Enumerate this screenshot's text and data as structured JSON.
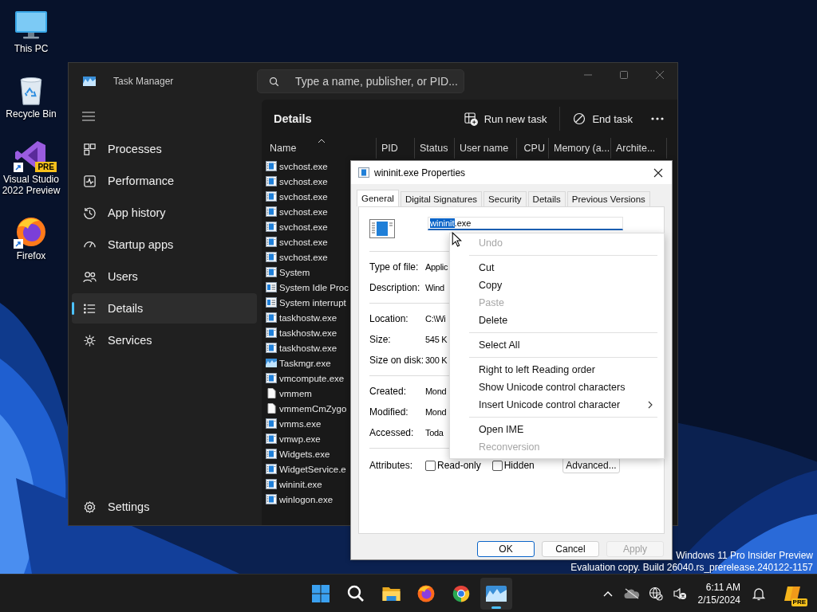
{
  "desktop_icons": [
    {
      "label": "This PC",
      "kind": "pc"
    },
    {
      "label": "Recycle Bin",
      "kind": "bin"
    },
    {
      "label": "Visual Studio 2022 Preview",
      "kind": "vs",
      "badge": "PRE"
    },
    {
      "label": "Firefox",
      "kind": "firefox"
    }
  ],
  "task_manager": {
    "title": "Task Manager",
    "search": {
      "placeholder": "Type a name, publisher, or PID..."
    },
    "nav": [
      {
        "label": "Processes",
        "kind": "processes",
        "selected": false
      },
      {
        "label": "Performance",
        "kind": "performance",
        "selected": false
      },
      {
        "label": "App history",
        "kind": "history",
        "selected": false
      },
      {
        "label": "Startup apps",
        "kind": "startup",
        "selected": false
      },
      {
        "label": "Users",
        "kind": "users",
        "selected": false
      },
      {
        "label": "Details",
        "kind": "details",
        "selected": true
      },
      {
        "label": "Services",
        "kind": "services",
        "selected": false
      }
    ],
    "settings": "Settings",
    "page_title": "Details",
    "actions": [
      {
        "label": "Run new task",
        "kind": "run"
      },
      {
        "label": "End task",
        "kind": "end"
      }
    ],
    "columns": [
      {
        "label": "Name",
        "sorted": true
      },
      {
        "label": "PID",
        "sorted": false
      },
      {
        "label": "Status",
        "sorted": false
      },
      {
        "label": "User name",
        "sorted": false
      },
      {
        "label": "CPU",
        "sorted": false
      },
      {
        "label": "Memory (a...",
        "sorted": false
      },
      {
        "label": "Archite...",
        "sorted": false
      }
    ],
    "rows": [
      {
        "name": "svchost.exe",
        "kind": "exe"
      },
      {
        "name": "svchost.exe",
        "kind": "exe"
      },
      {
        "name": "svchost.exe",
        "kind": "exe"
      },
      {
        "name": "svchost.exe",
        "kind": "exe"
      },
      {
        "name": "svchost.exe",
        "kind": "exe"
      },
      {
        "name": "svchost.exe",
        "kind": "exe"
      },
      {
        "name": "svchost.exe",
        "kind": "exe"
      },
      {
        "name": "System",
        "kind": "exe"
      },
      {
        "name": "System Idle Proc",
        "kind": "system"
      },
      {
        "name": "System interrupt",
        "kind": "system"
      },
      {
        "name": "taskhostw.exe",
        "kind": "exe"
      },
      {
        "name": "taskhostw.exe",
        "kind": "exe"
      },
      {
        "name": "taskhostw.exe",
        "kind": "exe"
      },
      {
        "name": "Taskmgr.exe",
        "kind": "taskmgr"
      },
      {
        "name": "vmcompute.exe",
        "kind": "exe"
      },
      {
        "name": "vmmem",
        "kind": "file"
      },
      {
        "name": "vmmemCmZygo",
        "kind": "file"
      },
      {
        "name": "vmms.exe",
        "kind": "exe"
      },
      {
        "name": "vmwp.exe",
        "kind": "exe"
      },
      {
        "name": "Widgets.exe",
        "kind": "exe"
      },
      {
        "name": "WidgetService.e",
        "kind": "exe"
      },
      {
        "name": "wininit.exe",
        "kind": "exe"
      },
      {
        "name": "winlogon.exe",
        "kind": "exe"
      }
    ]
  },
  "properties": {
    "title": "wininit.exe Properties",
    "tabs": [
      {
        "label": "General",
        "selected": true
      },
      {
        "label": "Digital Signatures",
        "selected": false
      },
      {
        "label": "Security",
        "selected": false
      },
      {
        "label": "Details",
        "selected": false
      },
      {
        "label": "Previous Versions",
        "selected": false
      }
    ],
    "file_name": {
      "selected_text": "wininit",
      "text": ".exe"
    },
    "groups": [
      [
        {
          "label": "Type of file:",
          "value": "Applic"
        },
        {
          "label": "Description:",
          "value": "Wind"
        }
      ],
      [
        {
          "label": "Location:",
          "value": "C:\\Wi"
        },
        {
          "label": "Size:",
          "value": "545 K"
        },
        {
          "label": "Size on disk:",
          "value": "300 K"
        }
      ],
      [
        {
          "label": "Created:",
          "value": "Mond"
        },
        {
          "label": "Modified:",
          "value": "Mond"
        },
        {
          "label": "Accessed:",
          "value": "Toda"
        }
      ]
    ],
    "attributes": {
      "label": "Attributes:",
      "checkboxes": [
        {
          "label": "Read-only",
          "checked": false
        },
        {
          "label": "Hidden",
          "checked": false
        }
      ],
      "advanced": "Advanced..."
    },
    "buttons": [
      {
        "label": "OK",
        "default": true,
        "disabled": false
      },
      {
        "label": "Cancel",
        "default": false,
        "disabled": false
      },
      {
        "label": "Apply",
        "default": false,
        "disabled": true
      }
    ]
  },
  "context_menu": {
    "groups": [
      [
        {
          "label": "Undo",
          "disabled": true,
          "submenu": false
        }
      ],
      [
        {
          "label": "Cut",
          "disabled": false,
          "submenu": false
        },
        {
          "label": "Copy",
          "disabled": false,
          "submenu": false
        },
        {
          "label": "Paste",
          "disabled": true,
          "submenu": false
        },
        {
          "label": "Delete",
          "disabled": false,
          "submenu": false
        }
      ],
      [
        {
          "label": "Select All",
          "disabled": false,
          "submenu": false
        }
      ],
      [
        {
          "label": "Right to left Reading order",
          "disabled": false,
          "submenu": false
        },
        {
          "label": "Show Unicode control characters",
          "disabled": false,
          "submenu": false
        },
        {
          "label": "Insert Unicode control character",
          "disabled": false,
          "submenu": true
        }
      ],
      [
        {
          "label": "Open IME",
          "disabled": false,
          "submenu": false
        },
        {
          "label": "Reconversion",
          "disabled": true,
          "submenu": false
        }
      ]
    ]
  },
  "watermark": [
    "Windows 11 Pro Insider Preview",
    "Evaluation copy. Build 26040.rs_prerelease.240122-1157"
  ],
  "taskbar": {
    "apps": [
      {
        "kind": "start",
        "active": false
      },
      {
        "kind": "search",
        "active": false
      },
      {
        "kind": "folder",
        "active": false
      },
      {
        "kind": "firefox",
        "active": false
      },
      {
        "kind": "chrome",
        "active": false
      },
      {
        "kind": "taskmgr",
        "active": true
      }
    ],
    "tray": [
      {
        "kind": "chevron"
      },
      {
        "kind": "cloud"
      },
      {
        "kind": "network"
      },
      {
        "kind": "volume"
      },
      {
        "kind": "clock",
        "time": "6:11 AM",
        "date": "2/15/2024"
      },
      {
        "kind": "bell"
      },
      {
        "kind": "copilot",
        "badge": "PRE"
      }
    ]
  }
}
